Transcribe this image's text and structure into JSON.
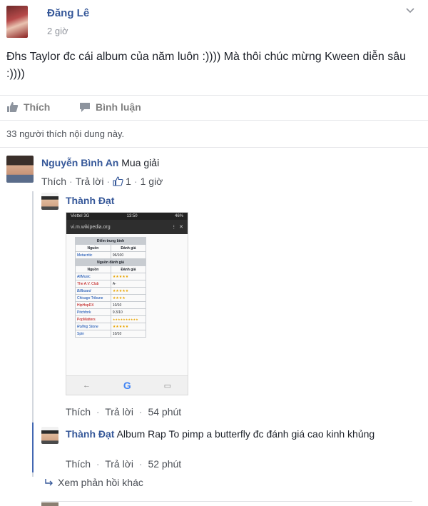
{
  "post": {
    "author": "Đăng Lê",
    "time": "2 giờ",
    "text": "Đhs Taylor đc cái album của năm luôn :)))) Mà thôi chúc mừng Kween diễn sâu :))))",
    "like_label": "Thích",
    "comment_label": "Bình luận",
    "likes_summary": "33 người thích nội dung này."
  },
  "comments": [
    {
      "author": "Nguyễn Bình An",
      "text": "Mua giải",
      "like_label": "Thích",
      "reply_label": "Trả lời",
      "like_count": "1",
      "time": "1 giờ"
    }
  ],
  "replies": [
    {
      "author": "Thành Đạt",
      "like_label": "Thích",
      "reply_label": "Trả lời",
      "time": "54 phút"
    },
    {
      "author": "Thành Đạt",
      "text": "Album Rap To pimp a butterfly đc đánh giá cao kinh khủng",
      "like_label": "Thích",
      "reply_label": "Trả lời",
      "time": "52 phút"
    }
  ],
  "more_replies": "Xem phản hồi khác",
  "screenshot": {
    "carrier": "Viettel 3G",
    "clock": "13:50",
    "battery": "46%",
    "url": "vi.m.wikipedia.org",
    "avg_header": "Điểm trung bình",
    "col_source": "Nguồn",
    "col_rating": "Đánh giá",
    "avg_rows": [
      [
        "Metacritic",
        "96/100"
      ]
    ],
    "review_header": "Nguồn đánh giá",
    "review_rows": [
      [
        "AllMusic",
        "★★★★★"
      ],
      [
        "The A.V. Club",
        "A-"
      ],
      [
        "Billboard",
        "★★★★★"
      ],
      [
        "Chicago Tribune",
        "★★★★"
      ],
      [
        "HipHopDX",
        "10/10"
      ],
      [
        "Pitchfork",
        "9.3/10"
      ],
      [
        "PopMatters",
        "★★★★★★★★★★"
      ],
      [
        "Rolling Stone",
        "★★★★★"
      ],
      [
        "Spin",
        "10/10"
      ]
    ]
  },
  "colors": {
    "link": "#365899",
    "meta": "#90949c",
    "border": "#e5e6e9"
  }
}
